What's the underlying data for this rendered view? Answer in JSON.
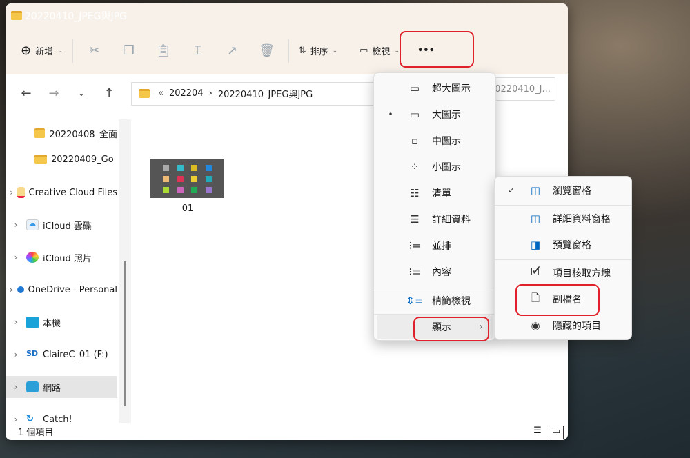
{
  "window": {
    "title": "20220410_JPEG與JPG"
  },
  "toolbar": {
    "new_label": "新增",
    "sort_label": "排序",
    "view_label": "檢視",
    "more_label": "•••",
    "icons": [
      "cut-icon",
      "copy-icon",
      "paste-icon",
      "rename-icon",
      "share-icon",
      "delete-icon"
    ]
  },
  "address": {
    "overflow": "«",
    "segments": [
      "202204",
      "20220410_JPEG與JPG"
    ],
    "search_placeholder": "20220410_J..."
  },
  "nav": {
    "items": [
      {
        "label": "20220408_全面",
        "icon": "folder"
      },
      {
        "label": "20220409_Go",
        "icon": "folder"
      },
      {
        "label": "Creative Cloud Files",
        "icon": "creative-cloud"
      },
      {
        "label": "iCloud 雲碟",
        "icon": "icloud-drive"
      },
      {
        "label": "iCloud 照片",
        "icon": "icloud-photos"
      },
      {
        "label": "OneDrive - Personal",
        "icon": "onedrive"
      },
      {
        "label": "本機",
        "icon": "this-pc"
      },
      {
        "label": "ClaireC_01 (F:)",
        "icon": "sd-card"
      },
      {
        "label": "網路",
        "icon": "network",
        "selected": true
      },
      {
        "label": "Catch!",
        "icon": "catch"
      }
    ]
  },
  "content": {
    "files": [
      {
        "name": "01"
      }
    ]
  },
  "status": {
    "count": "1 個項目"
  },
  "view_menu": {
    "items": [
      {
        "label": "超大圖示",
        "icon": "extra-large-icons"
      },
      {
        "label": "大圖示",
        "icon": "large-icons",
        "selected": true
      },
      {
        "label": "中圖示",
        "icon": "medium-icons"
      },
      {
        "label": "小圖示",
        "icon": "small-icons"
      },
      {
        "label": "清單",
        "icon": "list"
      },
      {
        "label": "詳細資料",
        "icon": "details"
      },
      {
        "label": "並排",
        "icon": "tiles"
      },
      {
        "label": "內容",
        "icon": "content"
      },
      {
        "label": "精簡檢視",
        "icon": "compact-view"
      },
      {
        "label": "顯示",
        "icon": "submenu"
      }
    ]
  },
  "show_menu": {
    "items": [
      {
        "label": "瀏覽窗格",
        "checked": true
      },
      {
        "label": "詳細資料窗格"
      },
      {
        "label": "預覽窗格"
      },
      {
        "label": "項目核取方塊"
      },
      {
        "label": "副檔名"
      },
      {
        "label": "隱藏的項目"
      }
    ]
  },
  "colors": {
    "highlight": "#e0202a",
    "accent": "#0067c0",
    "folder": "#f4c64a"
  }
}
